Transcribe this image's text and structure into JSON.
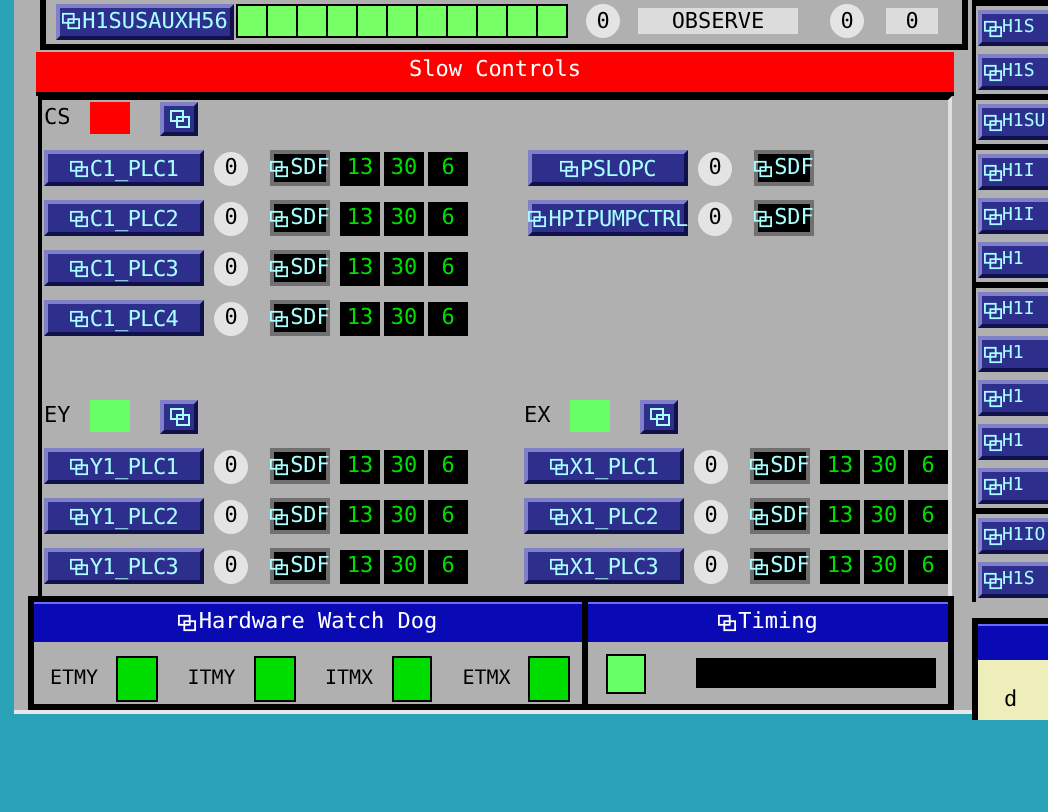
{
  "top_bar": {
    "button": "H1SUSAUXH56",
    "segments": [
      {
        "on": true
      },
      {
        "on": true
      },
      {
        "on": true
      },
      {
        "on": true
      },
      {
        "on": true
      },
      {
        "on": true
      },
      {
        "on": true
      },
      {
        "on": true
      },
      {
        "on": true
      },
      {
        "on": true
      },
      {
        "on": true
      }
    ],
    "count_1": "0",
    "mode": "OBSERVE",
    "count_2": "0",
    "count_3": "0"
  },
  "slow_controls": {
    "title": "Slow Controls",
    "cs": {
      "label": "CS",
      "color": "#ff0000",
      "rows": [
        {
          "button": "C1_PLC1",
          "count": "0",
          "sdf": "SDF",
          "values": [
            "13",
            "30",
            "6"
          ]
        },
        {
          "button": "C1_PLC2",
          "count": "0",
          "sdf": "SDF",
          "values": [
            "13",
            "30",
            "6"
          ]
        },
        {
          "button": "C1_PLC3",
          "count": "0",
          "sdf": "SDF",
          "values": [
            "13",
            "30",
            "6"
          ]
        },
        {
          "button": "C1_PLC4",
          "count": "0",
          "sdf": "SDF",
          "values": [
            "13",
            "30",
            "6"
          ]
        }
      ],
      "side_rows": [
        {
          "button": "PSLOPC",
          "count": "0",
          "sdf": "SDF"
        },
        {
          "button": "HPIPUMPCTRL",
          "count": "0",
          "sdf": "SDF"
        }
      ]
    },
    "ey": {
      "label": "EY",
      "color": "#66ff66",
      "rows": [
        {
          "button": "Y1_PLC1",
          "count": "0",
          "sdf": "SDF",
          "values": [
            "13",
            "30",
            "6"
          ]
        },
        {
          "button": "Y1_PLC2",
          "count": "0",
          "sdf": "SDF",
          "values": [
            "13",
            "30",
            "6"
          ]
        },
        {
          "button": "Y1_PLC3",
          "count": "0",
          "sdf": "SDF",
          "values": [
            "13",
            "30",
            "6"
          ]
        }
      ]
    },
    "ex": {
      "label": "EX",
      "color": "#66ff66",
      "rows": [
        {
          "button": "X1_PLC1",
          "count": "0",
          "sdf": "SDF",
          "values": [
            "13",
            "30",
            "6"
          ]
        },
        {
          "button": "X1_PLC2",
          "count": "0",
          "sdf": "SDF",
          "values": [
            "13",
            "30",
            "6"
          ]
        },
        {
          "button": "X1_PLC3",
          "count": "0",
          "sdf": "SDF",
          "values": [
            "13",
            "30",
            "6"
          ]
        }
      ]
    }
  },
  "watchdog": {
    "title": "Hardware Watch Dog",
    "indicators": [
      {
        "label": "ETMY",
        "color": "#00dd00"
      },
      {
        "label": "ITMY",
        "color": "#00dd00"
      },
      {
        "label": "ITMX",
        "color": "#00dd00"
      },
      {
        "label": "ETMX",
        "color": "#00dd00"
      }
    ]
  },
  "timing": {
    "title": "Timing",
    "color": "#66ff66"
  },
  "right_column": {
    "groups": [
      {
        "buttons": [
          "H1S",
          "H1S"
        ]
      },
      {
        "buttons": [
          "H1SU"
        ]
      },
      {
        "buttons": [
          "H1I",
          "H1I",
          "H1"
        ]
      },
      {
        "buttons": [
          "H1I",
          "H1",
          "H1",
          "H1",
          "H1"
        ]
      },
      {
        "buttons": [
          "H1IO",
          "H1S"
        ]
      }
    ],
    "panel_text": "d"
  }
}
